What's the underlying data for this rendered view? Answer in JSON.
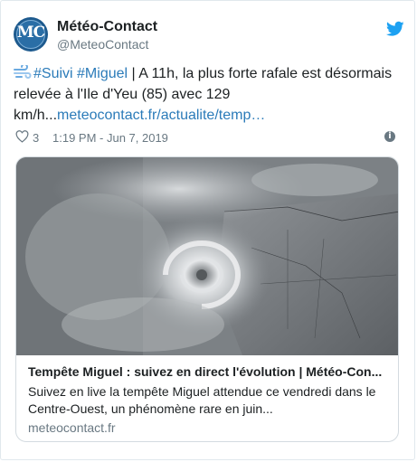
{
  "author": {
    "name": "Météo-Contact",
    "handle": "@MeteoContact",
    "avatar_icon": "meteo-contact-logo-icon",
    "avatar_initials": "MC"
  },
  "tweet": {
    "hashtag_1": "#Suivi",
    "hashtag_2": "#Miguel",
    "body_1": " | A 11h, la plus forte rafale est désormais relevée à l'Ile d'Yeu (85) avec 129 km/h...",
    "link": "meteocontact.fr/actualite/temp…",
    "emoji_icon": "wind-icon"
  },
  "meta": {
    "likes": "3",
    "timestamp": "1:19 PM - Jun 7, 2019",
    "info_glyph": "i"
  },
  "card": {
    "title": "Tempête Miguel : suivez en direct l'évolution | Météo-Con...",
    "description": "Suivez en live la tempête Miguel attendue ce vendredi dans le Centre-Ouest, un phénomène rare en juin...",
    "domain": "meteocontact.fr",
    "image_icon": "satellite-storm-image"
  },
  "colors": {
    "link": "#2b7bb9",
    "twitter_blue": "#1da1f2",
    "muted": "#697882"
  }
}
